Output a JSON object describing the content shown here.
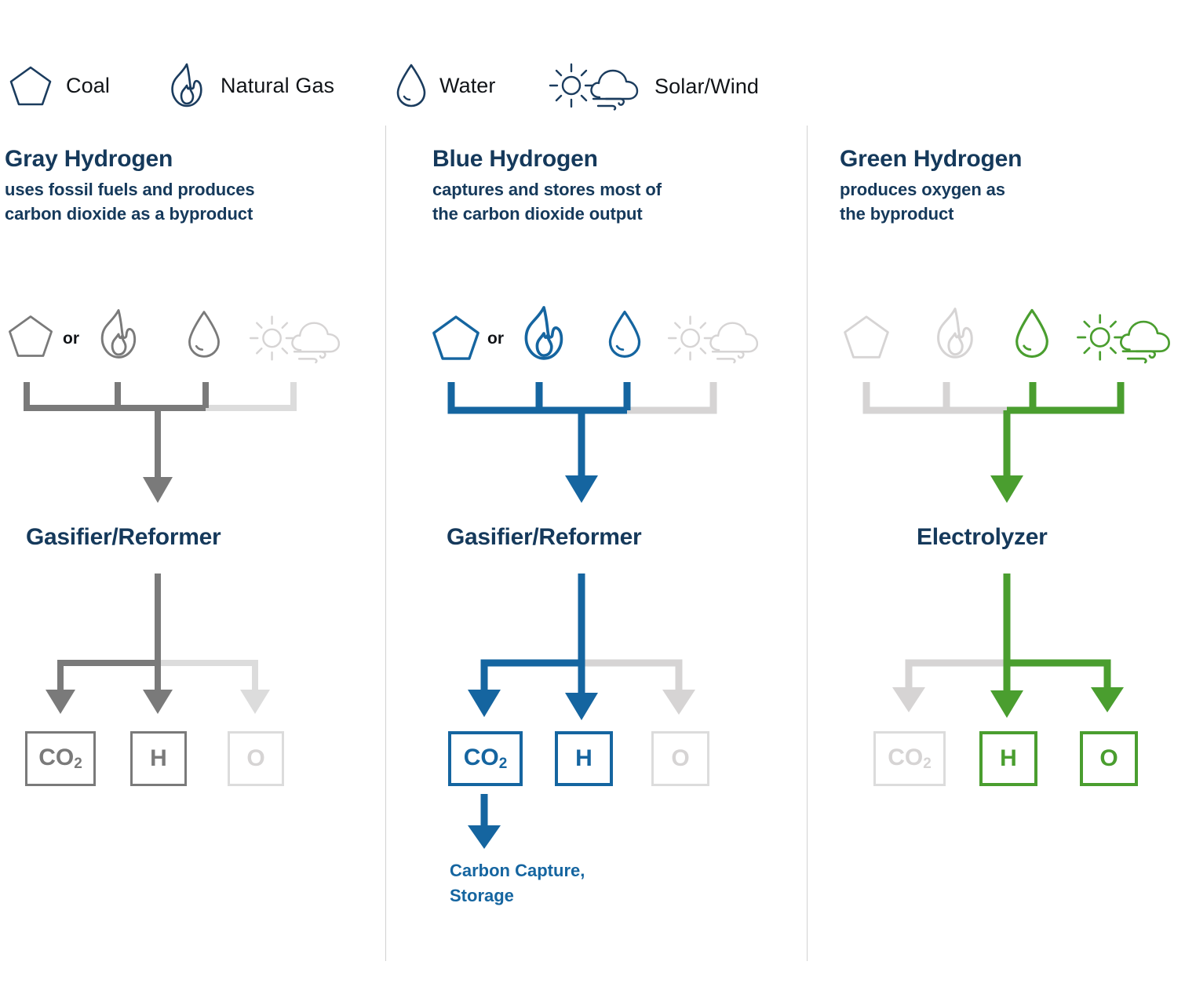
{
  "colors": {
    "navy": "#15395b",
    "gray_active": "#7a7a7a",
    "blue_active": "#1565a0",
    "green_active": "#4a9e2f",
    "inactive": "#d6d4d4",
    "text": "#111418",
    "divider": "#d2d2d2"
  },
  "legend": {
    "items": [
      {
        "icon": "pentagon-coal-icon",
        "label": "Coal"
      },
      {
        "icon": "flame-natural-gas-icon",
        "label": "Natural Gas"
      },
      {
        "icon": "droplet-water-icon",
        "label": "Water"
      },
      {
        "icon": "sun-cloud-solar-wind-icon",
        "label": "Solar/Wind"
      }
    ]
  },
  "columns": [
    {
      "id": "gray",
      "title": "Gray Hydrogen",
      "subtitle_lines": [
        "uses fossil fuels and produces",
        "carbon dioxide as a byproduct"
      ],
      "accent": "#7a7a7a",
      "inputs": [
        {
          "icon": "pentagon-coal-icon",
          "name": "Coal",
          "active": true
        },
        {
          "icon": "flame-natural-gas-icon",
          "name": "Natural Gas",
          "active": true
        },
        {
          "icon": "droplet-water-icon",
          "name": "Water",
          "active": true
        },
        {
          "icon": "sun-cloud-solar-wind-icon",
          "name": "Solar/Wind",
          "active": false
        }
      ],
      "or_label": "or",
      "process": "Gasifier/Reformer",
      "outputs": [
        {
          "label": "CO",
          "sub": "2",
          "active": true
        },
        {
          "label": "H",
          "sub": "",
          "active": true
        },
        {
          "label": "O",
          "sub": "",
          "active": false
        }
      ],
      "footnote_lines": []
    },
    {
      "id": "blue",
      "title": "Blue Hydrogen",
      "subtitle_lines": [
        "captures and stores most of",
        "the carbon dioxide output"
      ],
      "accent": "#1565a0",
      "inputs": [
        {
          "icon": "pentagon-coal-icon",
          "name": "Coal",
          "active": true
        },
        {
          "icon": "flame-natural-gas-icon",
          "name": "Natural Gas",
          "active": true
        },
        {
          "icon": "droplet-water-icon",
          "name": "Water",
          "active": true
        },
        {
          "icon": "sun-cloud-solar-wind-icon",
          "name": "Solar/Wind",
          "active": false
        }
      ],
      "or_label": "or",
      "process": "Gasifier/Reformer",
      "outputs": [
        {
          "label": "CO",
          "sub": "2",
          "active": true
        },
        {
          "label": "H",
          "sub": "",
          "active": true
        },
        {
          "label": "O",
          "sub": "",
          "active": false
        }
      ],
      "footnote_lines": [
        "Carbon Capture,",
        "Storage"
      ]
    },
    {
      "id": "green",
      "title": "Green Hydrogen",
      "subtitle_lines": [
        "produces oxygen as",
        "the byproduct"
      ],
      "accent": "#4a9e2f",
      "inputs": [
        {
          "icon": "pentagon-coal-icon",
          "name": "Coal",
          "active": false
        },
        {
          "icon": "flame-natural-gas-icon",
          "name": "Natural Gas",
          "active": false
        },
        {
          "icon": "droplet-water-icon",
          "name": "Water",
          "active": true
        },
        {
          "icon": "sun-cloud-solar-wind-icon",
          "name": "Solar/Wind",
          "active": true
        }
      ],
      "or_label": "",
      "process": "Electrolyzer",
      "outputs": [
        {
          "label": "CO",
          "sub": "2",
          "active": false
        },
        {
          "label": "H",
          "sub": "",
          "active": true
        },
        {
          "label": "O",
          "sub": "",
          "active": true
        }
      ],
      "footnote_lines": []
    }
  ]
}
